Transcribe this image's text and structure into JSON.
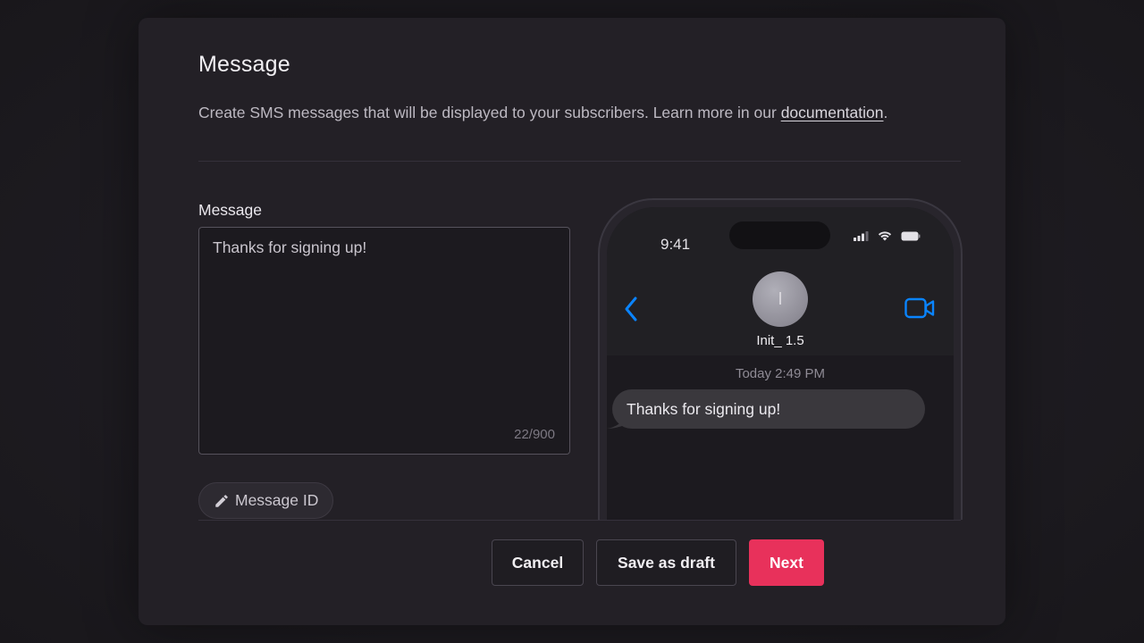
{
  "dialog": {
    "title": "Message",
    "description_prefix": "Create SMS messages that will be displayed to your subscribers. Learn more in our ",
    "description_link": "documentation",
    "description_suffix": "."
  },
  "editor": {
    "label": "Message",
    "value": "Thanks for signing up!",
    "char_count": "22/900"
  },
  "message_id_button": {
    "label": "Message ID",
    "icon": "pencil-icon"
  },
  "preview": {
    "status_time": "9:41",
    "contact_initial": "I",
    "contact_name": "Init_ 1.5",
    "timestamp": "Today 2:49 PM",
    "bubble_text": "Thanks for signing up!",
    "accent_color": "#0a84ff"
  },
  "footer": {
    "cancel_label": "Cancel",
    "draft_label": "Save as draft",
    "next_label": "Next",
    "next_color": "#e8315b"
  }
}
